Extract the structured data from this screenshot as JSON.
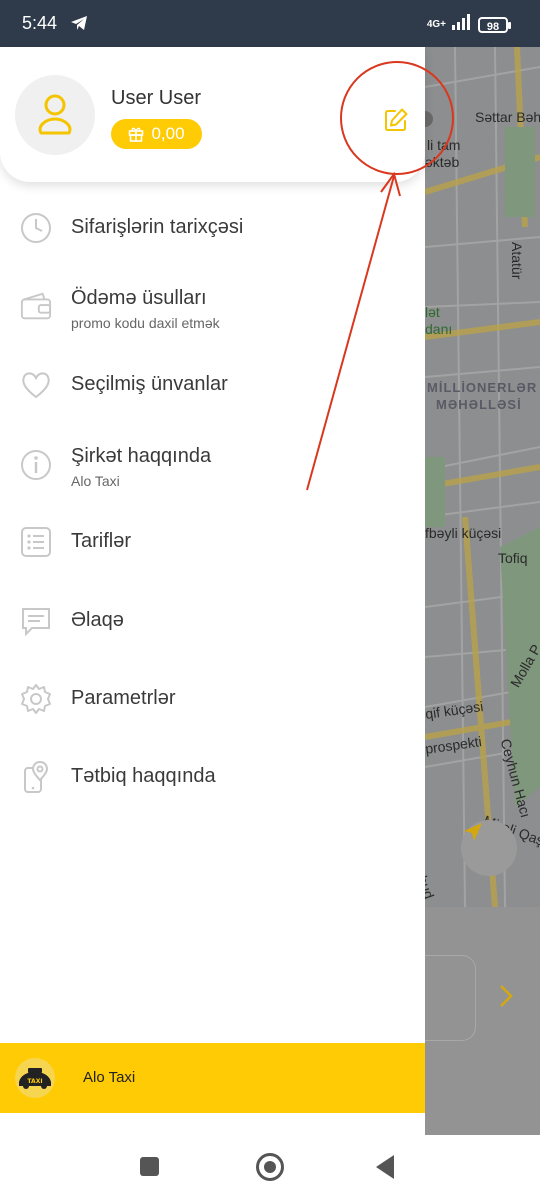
{
  "status_bar": {
    "time": "5:44",
    "network": "4G+",
    "battery": "98"
  },
  "profile": {
    "name": "User User",
    "balance": "0,00"
  },
  "menu": {
    "items": [
      {
        "label": "Sifarişlərin tarixçəsi",
        "icon": "clock-icon"
      },
      {
        "label": "Ödəmə üsulları",
        "sublabel": "promo kodu daxil etmək",
        "icon": "wallet-icon"
      },
      {
        "label": "Seçilmiş ünvanlar",
        "icon": "heart-icon"
      },
      {
        "label": "Şirkət haqqında",
        "sublabel": "Alo Taxi",
        "icon": "info-icon"
      },
      {
        "label": "Tariflər",
        "icon": "list-icon"
      },
      {
        "label": "Əlaqə",
        "icon": "chat-icon"
      },
      {
        "label": "Parametrlər",
        "icon": "gear-icon"
      },
      {
        "label": "Tətbiq haqqında",
        "icon": "phone-location-icon"
      }
    ]
  },
  "footer": {
    "brand": "Alo Taxi",
    "logo_text": "TAXI"
  },
  "map": {
    "labels": [
      "Səttar Bəhl",
      "li tam",
      "əktəb",
      "Atatür",
      "lət",
      "danı",
      "MİLLİONERLƏR",
      "MƏHƏLLƏSİ",
      "fbəyli küçəsi",
      "Tofiq",
      "Molla P",
      "qif küçəsi",
      "prospekti",
      "Ceyhun Hacı",
      "Mirəli Qaşqay küç",
      "şhud"
    ]
  },
  "colors": {
    "accent": "#ffcb05",
    "status_bar": "#2f3a4a",
    "annotation": "#d9381e"
  }
}
